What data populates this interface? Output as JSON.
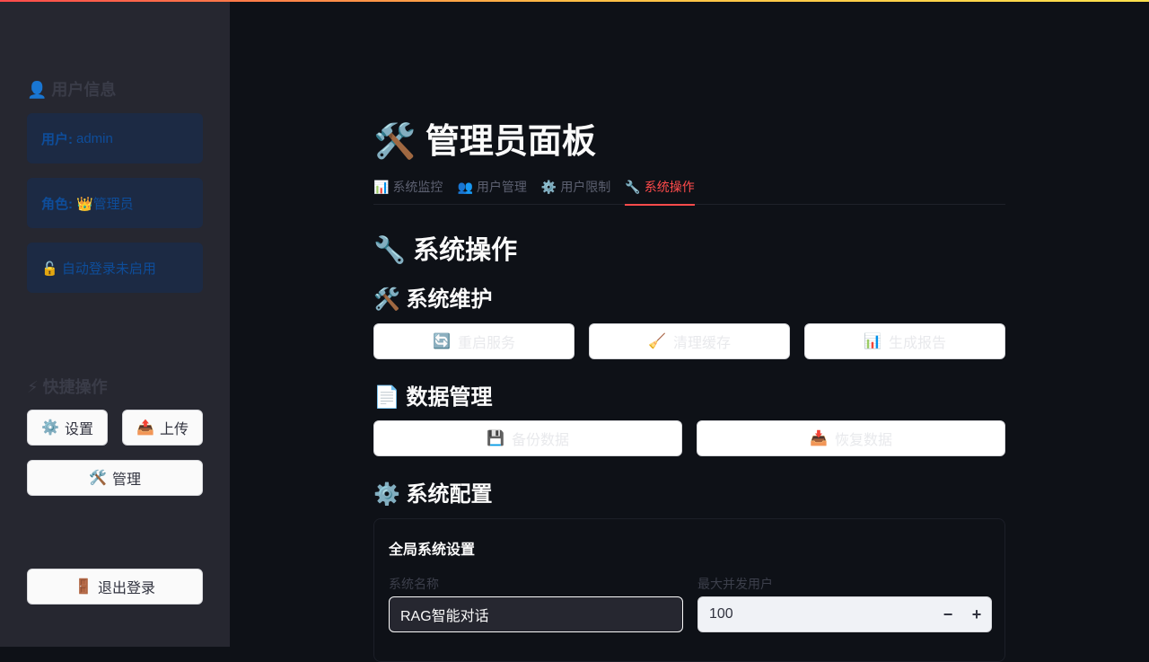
{
  "sidebar": {
    "user_info_heading": "👤 用户信息",
    "user_label": "用户:",
    "user_value": "admin",
    "role_label": "角色:",
    "role_value": "👑管理员",
    "autologin_text": "🔓 自动登录未启用",
    "quick_actions_heading": "⚡ 快捷操作",
    "settings_icon": "⚙️",
    "settings_label": "设置",
    "upload_icon": "📤",
    "upload_label": "上传",
    "admin_icon": "🛠️",
    "admin_label": "管理",
    "logout_icon": "🚪",
    "logout_label": "退出登录"
  },
  "main": {
    "page_title": "🛠️ 管理员面板",
    "tabs": [
      {
        "icon": "📊",
        "label": "系统监控"
      },
      {
        "icon": "👥",
        "label": "用户管理"
      },
      {
        "icon": "⚙️",
        "label": "用户限制"
      },
      {
        "icon": "🔧",
        "label": "系统操作"
      }
    ],
    "active_tab": "系统操作",
    "section_title": "🔧 系统操作",
    "maintenance": {
      "title": "🛠️ 系统维护",
      "buttons": [
        {
          "icon": "🔄",
          "label": "重启服务"
        },
        {
          "icon": "🧹",
          "label": "清理缓存"
        },
        {
          "icon": "📊",
          "label": "生成报告"
        }
      ]
    },
    "data_mgmt": {
      "title": "📄 数据管理",
      "buttons": [
        {
          "icon": "💾",
          "label": "备份数据"
        },
        {
          "icon": "📥",
          "label": "恢复数据"
        }
      ]
    },
    "config": {
      "title": "⚙️ 系统配置",
      "form_title": "全局系统设置",
      "system_name_label": "系统名称",
      "system_name_value": "RAG智能对话",
      "max_users_label": "最大并发用户",
      "max_users_value": "100",
      "minus": "−",
      "plus": "+"
    }
  },
  "colors": {
    "background": "#0e1117",
    "sidebar": "#262730",
    "accent": "#ff4b4b",
    "info_box": "#1c2a44"
  }
}
